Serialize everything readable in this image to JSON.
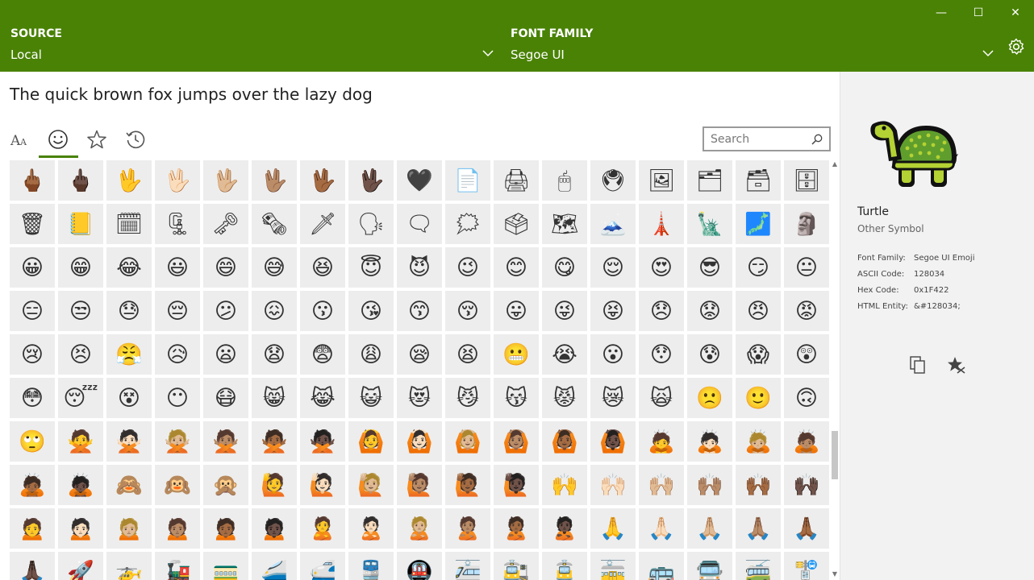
{
  "window_controls": {
    "minimize": "—",
    "maximize": "☐",
    "close": "✕"
  },
  "source": {
    "label": "SOURCE",
    "value": "Local"
  },
  "font_family": {
    "label": "FONT FAMILY",
    "value": "Segoe UI"
  },
  "sample_text": "The quick brown fox jumps over the lazy dog",
  "tabs": [
    {
      "name": "characters",
      "icon": "font-size-icon"
    },
    {
      "name": "emoji",
      "icon": "smiley-icon",
      "selected": true
    },
    {
      "name": "favorites",
      "icon": "star-icon"
    },
    {
      "name": "history",
      "icon": "history-icon"
    }
  ],
  "search": {
    "placeholder": "Search"
  },
  "emoji_rows": [
    [
      "🖕🏾",
      "🖕🏿",
      "🖖",
      "🖖🏻",
      "🖖🏼",
      "🖖🏽",
      "🖖🏾",
      "🖖🏿",
      "🖤",
      "📄",
      "🖨",
      "🖱",
      "🖲",
      "🖼",
      "🗂",
      "🗃",
      "🗄"
    ],
    [
      "🗑",
      "📒",
      "🗓",
      "🗜",
      "🗝",
      "🗞",
      "🗡",
      "🗣",
      "🗨",
      "🗯",
      "🗳",
      "🗺",
      "🗻",
      "🗼",
      "🗽",
      "🗾",
      "🗿"
    ],
    [
      "😀",
      "😁",
      "😂",
      "😃",
      "😄",
      "😅",
      "😆",
      "😇",
      "😈",
      "😉",
      "😊",
      "😋",
      "😌",
      "😍",
      "😎",
      "😏",
      "😐"
    ],
    [
      "😑",
      "😒",
      "😓",
      "😔",
      "😕",
      "😖",
      "😗",
      "😘",
      "😙",
      "😚",
      "😛",
      "😜",
      "😝",
      "😞",
      "😟",
      "😠",
      "😡"
    ],
    [
      "😢",
      "😣",
      "😤",
      "😥",
      "😦",
      "😧",
      "😨",
      "😩",
      "😪",
      "😫",
      "😬",
      "😭",
      "😮",
      "😯",
      "😰",
      "😱",
      "😲"
    ],
    [
      "😳",
      "😴",
      "😵",
      "😶",
      "😷",
      "😸",
      "😹",
      "😺",
      "😻",
      "😼",
      "😽",
      "😾",
      "😿",
      "🙀",
      "🙁",
      "🙂",
      "🙃"
    ],
    [
      "🙄",
      "🙅",
      "🙅🏻",
      "🙅🏼",
      "🙅🏽",
      "🙅🏾",
      "🙅🏿",
      "🙆",
      "🙆🏻",
      "🙆🏼",
      "🙆🏽",
      "🙆🏾",
      "🙆🏿",
      "🙇",
      "🙇🏻",
      "🙇🏼",
      "🙇🏽"
    ],
    [
      "🙇🏾",
      "🙇🏿",
      "🙈",
      "🙉",
      "🙊",
      "🙋",
      "🙋🏻",
      "🙋🏼",
      "🙋🏽",
      "🙋🏾",
      "🙋🏿",
      "🙌",
      "🙌🏻",
      "🙌🏼",
      "🙌🏽",
      "🙌🏾",
      "🙌🏿"
    ],
    [
      "🙍",
      "🙍🏻",
      "🙍🏼",
      "🙍🏽",
      "🙍🏾",
      "🙍🏿",
      "🙎",
      "🙎🏻",
      "🙎🏼",
      "🙎🏽",
      "🙎🏾",
      "🙎🏿",
      "🙏",
      "🙏🏻",
      "🙏🏼",
      "🙏🏽",
      "🙏🏾"
    ],
    [
      "🙏🏿",
      "🚀",
      "🚁",
      "🚂",
      "🚃",
      "🚄",
      "🚅",
      "🚆",
      "🚇",
      "🚈",
      "🚉",
      "🚊",
      "🚋",
      "🚌",
      "🚍",
      "🚎",
      "🚏"
    ]
  ],
  "selected": {
    "name": "Turtle",
    "category": "Other Symbol",
    "properties": [
      {
        "key": "Font Family:",
        "value": "Segoe UI Emoji"
      },
      {
        "key": "ASCII Code:",
        "value": "128034"
      },
      {
        "key": "Hex Code:",
        "value": "0x1F422"
      },
      {
        "key": "HTML Entity:",
        "value": "&#128034;"
      }
    ]
  },
  "actions": {
    "copy_icon": "copy-icon",
    "favorite_icon": "add-favorite-icon"
  },
  "colors": {
    "accent": "#498205",
    "cell_bg": "#ededed",
    "pane_bg": "#f2f2f2",
    "turtle_shell": "#5f9e2d",
    "turtle_body": "#b4d233"
  }
}
